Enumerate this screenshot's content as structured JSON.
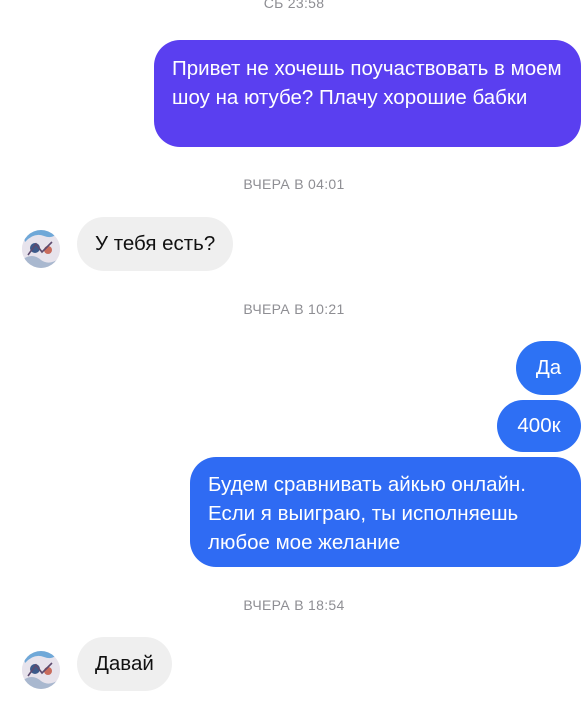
{
  "timestamps": [
    "СБ 23:58",
    "ВЧЕРА В 04:01",
    "ВЧЕРА В 10:21",
    "ВЧЕРА В 18:54"
  ],
  "messages": {
    "m1": "Привет не хочешь поучаствовать в моем шоу на ютубе? Плачу хорошие бабки",
    "m2": "У тебя есть?",
    "m3": "Да",
    "m4": "400к",
    "m5": "Будем сравнивать айкью онлайн. Если я выиграю, ты исполняешь любое мое желание",
    "m6": "Давай"
  },
  "colors": {
    "outgoing_purple": "#5a3ff0",
    "outgoing_blue": "#2f6bf3",
    "incoming_bg": "#efefef",
    "timestamp_text": "#8e8e93"
  },
  "icons": {
    "avatar": "contact-avatar-icon"
  }
}
